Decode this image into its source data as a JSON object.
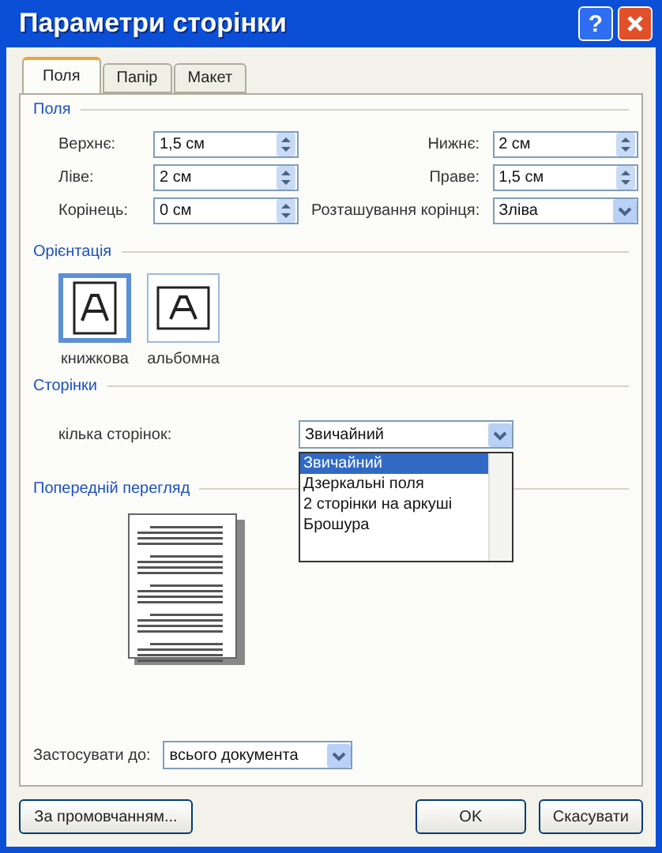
{
  "window": {
    "title": "Параметри сторінки",
    "help_label": "?"
  },
  "tabs": [
    {
      "label": "Поля",
      "selected": true
    },
    {
      "label": "Папір",
      "selected": false
    },
    {
      "label": "Макет",
      "selected": false
    }
  ],
  "margins": {
    "title": "Поля",
    "fields": [
      {
        "label": "Верхнє:",
        "value": "1,5 см",
        "kind": "spin"
      },
      {
        "label": "Нижнє:",
        "value": "2 см",
        "kind": "spin"
      },
      {
        "label": "Ліве:",
        "value": "2 см",
        "kind": "spin"
      },
      {
        "label": "Праве:",
        "value": "1,5 см",
        "kind": "spin"
      },
      {
        "label": "Корінець:",
        "value": "0 см",
        "kind": "spin"
      },
      {
        "label": "Розташування корінця:",
        "value": "Зліва",
        "kind": "select"
      }
    ]
  },
  "orientation": {
    "title": "Орієнтація",
    "options": [
      {
        "label": "книжкова",
        "selected": true
      },
      {
        "label": "альбомна",
        "selected": false
      }
    ]
  },
  "pages": {
    "title": "Сторінки",
    "label": "кілька сторінок:",
    "value": "Звичайний",
    "expanded": true,
    "options": [
      {
        "label": "Звичайний",
        "selected": true
      },
      {
        "label": "Дзеркальні поля",
        "selected": false
      },
      {
        "label": "2 сторінки на аркуші",
        "selected": false
      },
      {
        "label": "Брошура",
        "selected": false
      }
    ]
  },
  "preview": {
    "title": "Попередній перегляд"
  },
  "apply": {
    "label": "Застосувати до:",
    "value": "всього документа"
  },
  "buttons": [
    {
      "kind": "default",
      "label": "За промовчанням..."
    },
    {
      "kind": "ok",
      "label": "OK"
    },
    {
      "kind": "cancel",
      "label": "Скасувати"
    }
  ]
}
